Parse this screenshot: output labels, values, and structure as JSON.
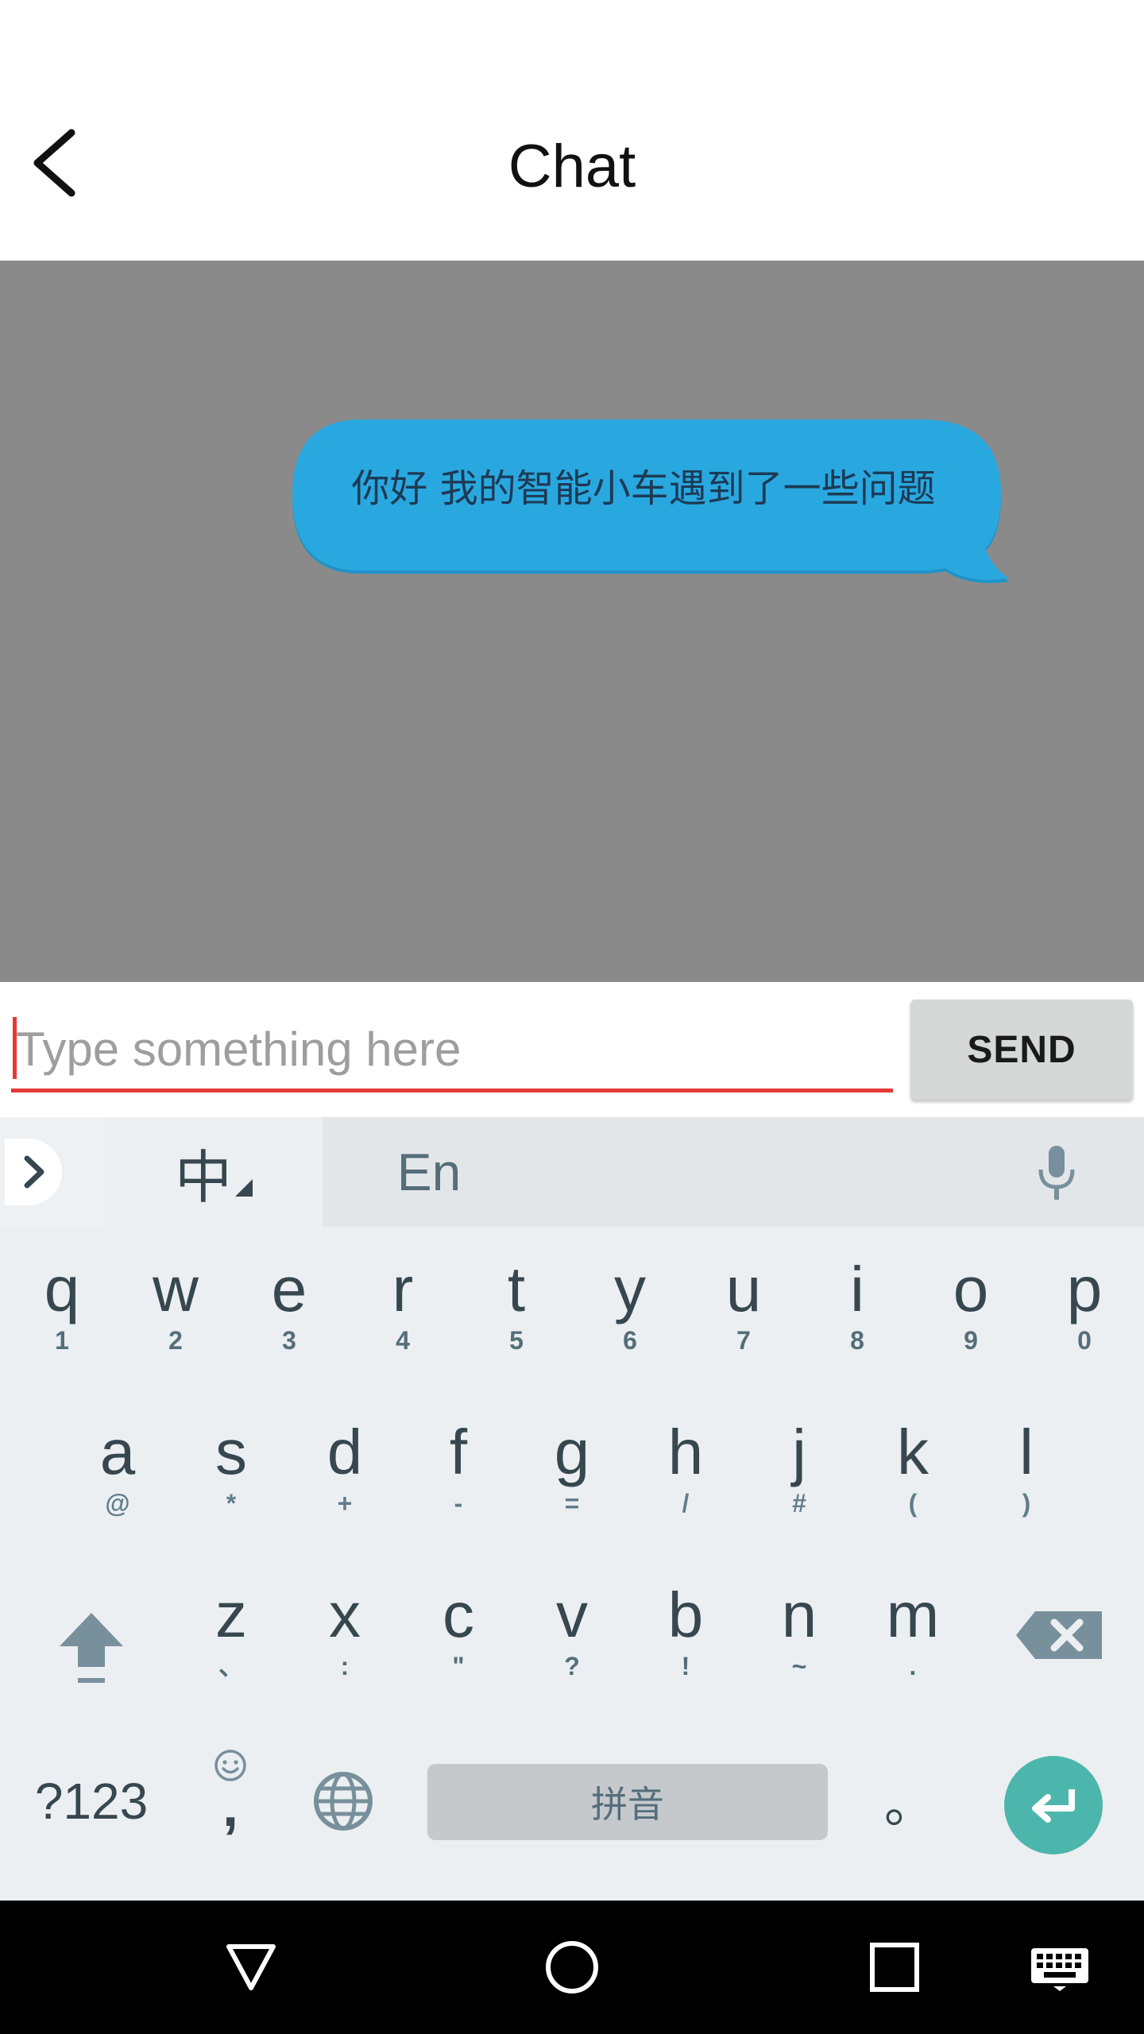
{
  "header": {
    "title": "Chat",
    "back_icon": "chevron-left-icon"
  },
  "chat": {
    "messages": [
      {
        "text": "你好 我的智能小车遇到了一些问题",
        "bubble_color": "#29a8e0"
      }
    ],
    "background_color": "#8a8a8a"
  },
  "composer": {
    "placeholder": "Type something here",
    "value": "",
    "send_label": "SEND",
    "accent_color": "#e53935"
  },
  "keyboard": {
    "toolbar": {
      "expand_icon": "chevron-right-icon",
      "lang_zh": "中",
      "lang_en": "En",
      "mic_icon": "mic-icon"
    },
    "row1": [
      {
        "k": "q",
        "s": "1"
      },
      {
        "k": "w",
        "s": "2"
      },
      {
        "k": "e",
        "s": "3"
      },
      {
        "k": "r",
        "s": "4"
      },
      {
        "k": "t",
        "s": "5"
      },
      {
        "k": "y",
        "s": "6"
      },
      {
        "k": "u",
        "s": "7"
      },
      {
        "k": "i",
        "s": "8"
      },
      {
        "k": "o",
        "s": "9"
      },
      {
        "k": "p",
        "s": "0"
      }
    ],
    "row2": [
      {
        "k": "a",
        "s": "@"
      },
      {
        "k": "s",
        "s": "*"
      },
      {
        "k": "d",
        "s": "+"
      },
      {
        "k": "f",
        "s": "-"
      },
      {
        "k": "g",
        "s": "="
      },
      {
        "k": "h",
        "s": "/"
      },
      {
        "k": "j",
        "s": "#"
      },
      {
        "k": "k",
        "s": "("
      },
      {
        "k": "l",
        "s": ")"
      }
    ],
    "row3": [
      {
        "k": "z",
        "s": "、"
      },
      {
        "k": "x",
        "s": ":"
      },
      {
        "k": "c",
        "s": "\""
      },
      {
        "k": "v",
        "s": "?"
      },
      {
        "k": "b",
        "s": "!"
      },
      {
        "k": "n",
        "s": "~"
      },
      {
        "k": "m",
        "s": "."
      }
    ],
    "bottom": {
      "symbols": "?123",
      "comma": ",",
      "space": "拼音",
      "period": "。",
      "enter_color": "#4db6ac"
    }
  },
  "navbar": {
    "back_icon": "triangle-back-icon",
    "home_icon": "circle-home-icon",
    "recents_icon": "square-recents-icon",
    "keyboard_icon": "keyboard-icon"
  }
}
